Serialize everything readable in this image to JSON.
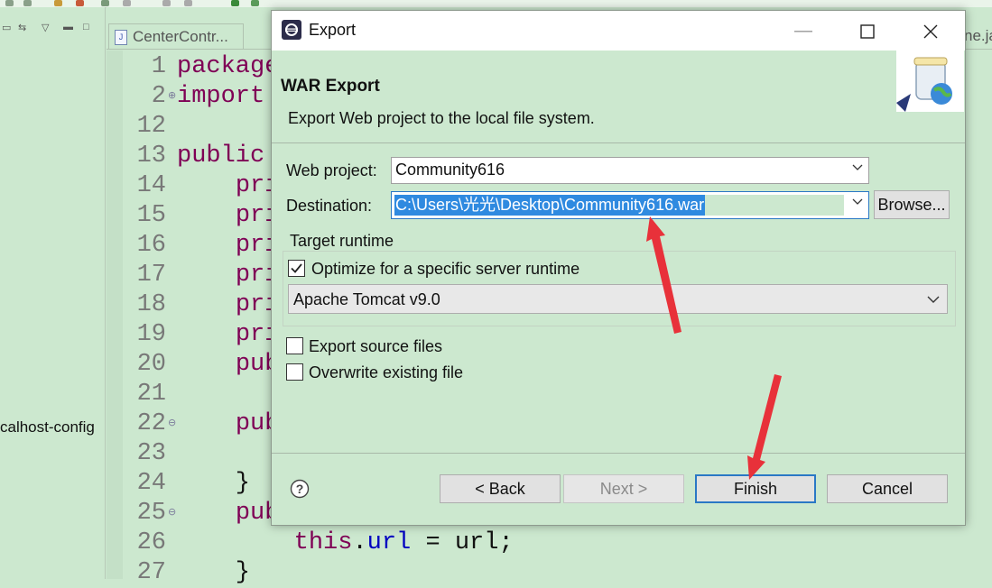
{
  "ide": {
    "editor_tab_label": "CenterContr...",
    "editor_tab_right_label": "ne.ja",
    "tree_item_label": "calhost-config",
    "code_lines": [
      {
        "no": "1",
        "fold": "",
        "html": "<span class=\"kw\">package</span> com.example;"
      },
      {
        "no": "2",
        "fold": "+",
        "html": "<span class=\"kw\">import</span> java.util.*;"
      },
      {
        "no": "12",
        "fold": "",
        "html": ""
      },
      {
        "no": "13",
        "fold": "",
        "html": "<span class=\"kw\">public</span> class CenterController {"
      },
      {
        "no": "14",
        "fold": "",
        "html": "    <span class=\"kw\">private</span> String name;"
      },
      {
        "no": "15",
        "fold": "",
        "html": "    <span class=\"kw\">private</span> String url;"
      },
      {
        "no": "16",
        "fold": "",
        "html": "    <span class=\"kw\">private</span> String type;"
      },
      {
        "no": "17",
        "fold": "",
        "html": "    <span class=\"kw\">private</span> String path;"
      },
      {
        "no": "18",
        "fold": "",
        "html": "    <span class=\"kw\">private</span> String host;"
      },
      {
        "no": "19",
        "fold": "",
        "html": "    <span class=\"kw\">private</span> String port;"
      },
      {
        "no": "20",
        "fold": "",
        "html": "    <span class=\"kw\">public</span> CenterController() {"
      },
      {
        "no": "21",
        "fold": "",
        "html": ""
      },
      {
        "no": "22",
        "fold": "-",
        "html": "    <span class=\"kw\">public</span> String getUrl() {"
      },
      {
        "no": "23",
        "fold": "",
        "html": ""
      },
      {
        "no": "24",
        "fold": "",
        "html": "    }"
      },
      {
        "no": "25",
        "fold": "-",
        "html": "    <span class=\"kw\">public</span> void setUrl(String url) {"
      },
      {
        "no": "26",
        "fold": "",
        "html": "        <span class=\"kw\">this</span>.<span class=\"fld\">url</span> = url;"
      },
      {
        "no": "27",
        "fold": "",
        "html": "    }"
      }
    ]
  },
  "dialog": {
    "title": "Export",
    "header_title": "WAR Export",
    "header_description": "Export Web project to the local file system.",
    "web_project_label": "Web project:",
    "web_project_value": "Community616",
    "destination_label": "Destination:",
    "destination_value": "C:\\Users\\光光\\Desktop\\Community616.war",
    "browse_label": "Browse...",
    "target_runtime_title": "Target runtime",
    "optimize_label": "Optimize for a specific server runtime",
    "optimize_checked": true,
    "runtime_value": "Apache Tomcat v9.0",
    "export_source_label": "Export source files",
    "export_source_checked": false,
    "overwrite_label": "Overwrite existing file",
    "overwrite_checked": false,
    "back_label": "< Back",
    "next_label": "Next >",
    "finish_label": "Finish",
    "cancel_label": "Cancel"
  },
  "colors": {
    "background": "#cce8cf",
    "selection": "#2f8ae0",
    "focus_border": "#2a78c5",
    "annotation_arrow": "#e8313a"
  }
}
